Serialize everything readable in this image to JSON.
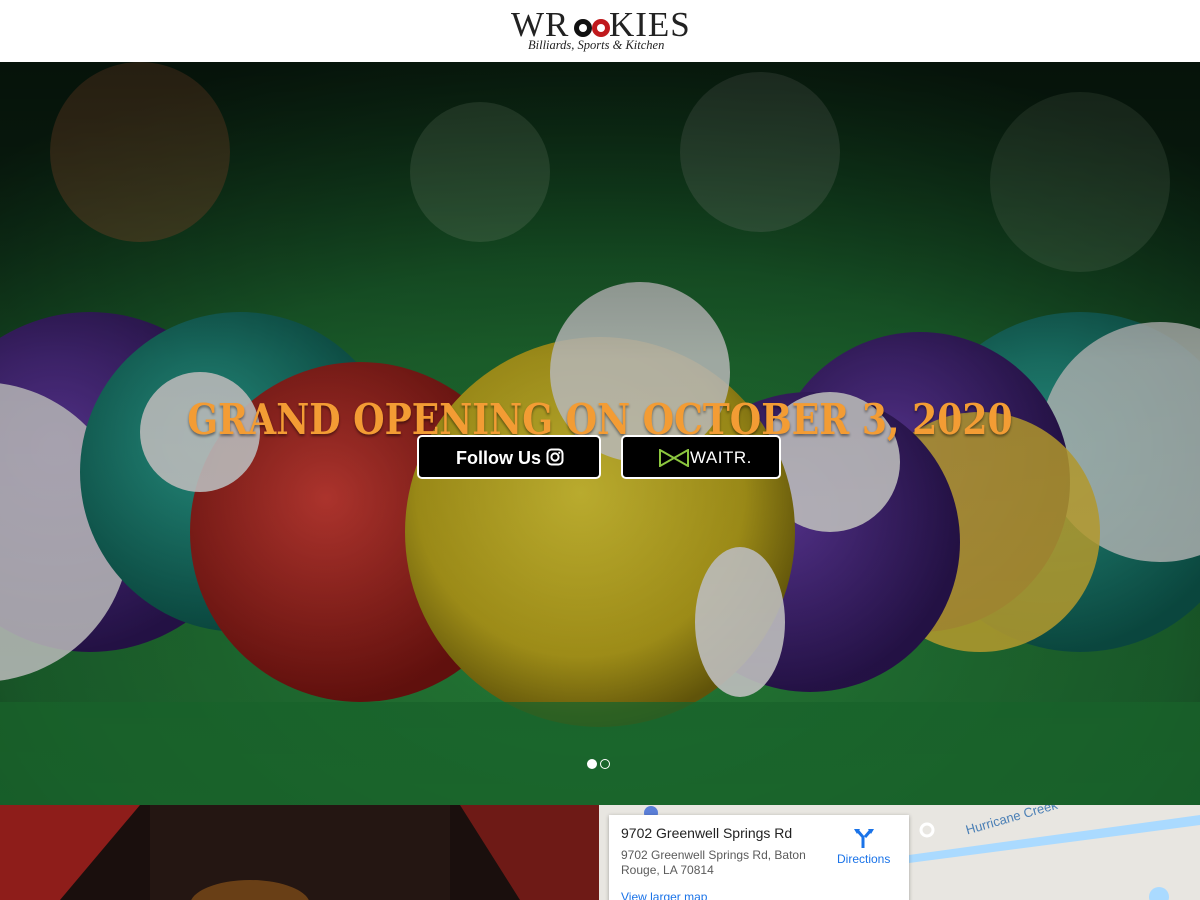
{
  "brand": {
    "logo_word_pre": "WR",
    "logo_word_post": "KIES",
    "tagline": "Billiards, Sports & Kitchen"
  },
  "hero": {
    "title": "GRAND OPENING ON OCTOBER 3, 2020",
    "follow_label": "Follow Us",
    "follow_icon": "instagram-icon",
    "waitr_label": "WAITR.",
    "slides": {
      "count": 2,
      "active": 1
    }
  },
  "map": {
    "place_name": "9702 Greenwell Springs Rd",
    "address": "9702 Greenwell Springs Rd, Baton Rouge, LA 70814",
    "directions_label": "Directions",
    "larger_map_label": "View larger map",
    "creek_label": "Hurricane Creek"
  },
  "colors": {
    "title": "#f39c34",
    "button_bg": "#000000",
    "link": "#1a73e8"
  }
}
